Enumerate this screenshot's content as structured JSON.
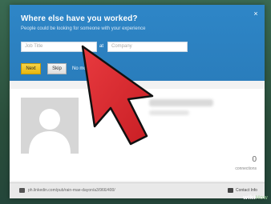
{
  "dialog": {
    "title": "Where else have you worked?",
    "subtitle": "People could be looking for someone with your experience",
    "job_title_placeholder": "Job Title",
    "at_label": "at",
    "company_placeholder": "Company",
    "next_label": "Next",
    "skip_label": "Skip",
    "no_more_label": "No mo",
    "close_glyph": "×"
  },
  "profile": {
    "connections_count": "0",
    "connections_label": "connections"
  },
  "footer": {
    "profile_url": "ph.linkedin.com/pub/rain-mae-dayon/a3/966/400/",
    "contact_info_label": "Contact Info"
  },
  "watermark": {
    "brand": "wiki",
    "brand_suffix": "How"
  },
  "colors": {
    "banner_blue": "#2a7dbc",
    "next_yellow": "#f0c419",
    "arrow_red": "#d9252b",
    "background_green": "#2f4f3e"
  },
  "icons": {
    "close": "close-icon",
    "link": "link-icon",
    "contact": "contact-card-icon",
    "pointer": "arrow-pointer-icon"
  }
}
